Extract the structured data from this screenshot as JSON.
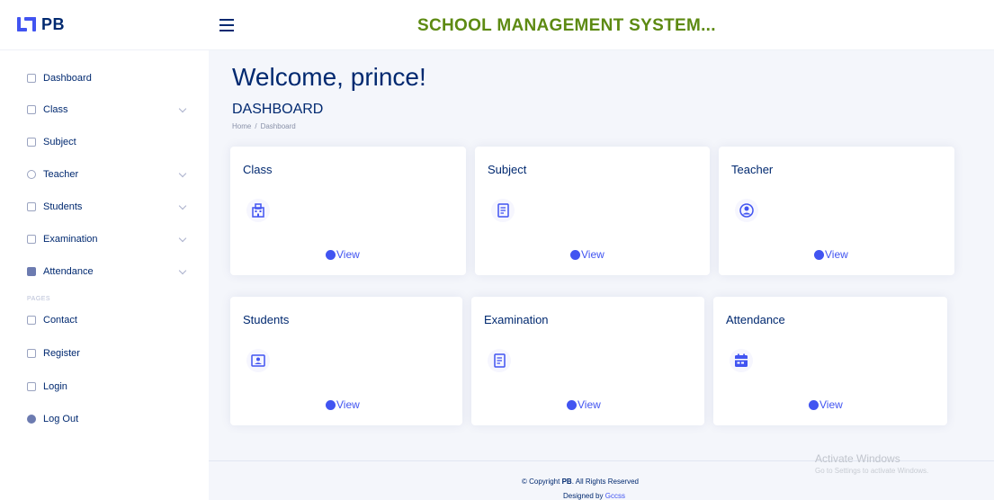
{
  "header": {
    "brand": "PB",
    "app_title": "SCHOOL MANAGEMENT SYSTEM..."
  },
  "sidebar": {
    "items": [
      {
        "label": "Dashboard",
        "icon": "grid-icon",
        "expandable": false
      },
      {
        "label": "Class",
        "icon": "building-icon",
        "expandable": true
      },
      {
        "label": "Subject",
        "icon": "journal-icon",
        "expandable": false
      },
      {
        "label": "Teacher",
        "icon": "person-icon",
        "expandable": true
      },
      {
        "label": "Students",
        "icon": "people-icon",
        "expandable": true
      },
      {
        "label": "Examination",
        "icon": "journal-text-icon",
        "expandable": true
      },
      {
        "label": "Attendance",
        "icon": "calendar-icon",
        "expandable": true
      }
    ],
    "pages_heading": "PAGES",
    "page_items": [
      {
        "label": "Contact",
        "icon": "envelope-icon"
      },
      {
        "label": "Register",
        "icon": "card-list-icon"
      },
      {
        "label": "Login",
        "icon": "login-icon"
      },
      {
        "label": "Log Out",
        "icon": "logout-icon"
      }
    ]
  },
  "main": {
    "welcome": "Welcome, prince!",
    "page_title": "DASHBOARD",
    "breadcrumb": [
      "Home",
      "Dashboard"
    ],
    "cards": [
      {
        "title": "Class",
        "icon": "building-icon",
        "link": "View"
      },
      {
        "title": "Subject",
        "icon": "journal-icon",
        "link": "View"
      },
      {
        "title": "Teacher",
        "icon": "person-circle-icon",
        "link": "View"
      },
      {
        "title": "Students",
        "icon": "person-badge-icon",
        "link": "View"
      },
      {
        "title": "Examination",
        "icon": "journal-text-icon",
        "link": "View"
      },
      {
        "title": "Attendance",
        "icon": "calendar-icon",
        "link": "View"
      }
    ]
  },
  "footer": {
    "copyright_prefix": "© Copyright",
    "copyright_brand": "PB",
    "copyright_suffix": "All Rights Reserved",
    "designed_prefix": "Designed by",
    "designed_link": "Gccss"
  },
  "watermark": {
    "line1": "Activate Windows",
    "line2": "Go to Settings to activate Windows."
  },
  "colors": {
    "accent": "#4154f1",
    "title_green": "#5d8a12",
    "navy": "#012970"
  }
}
